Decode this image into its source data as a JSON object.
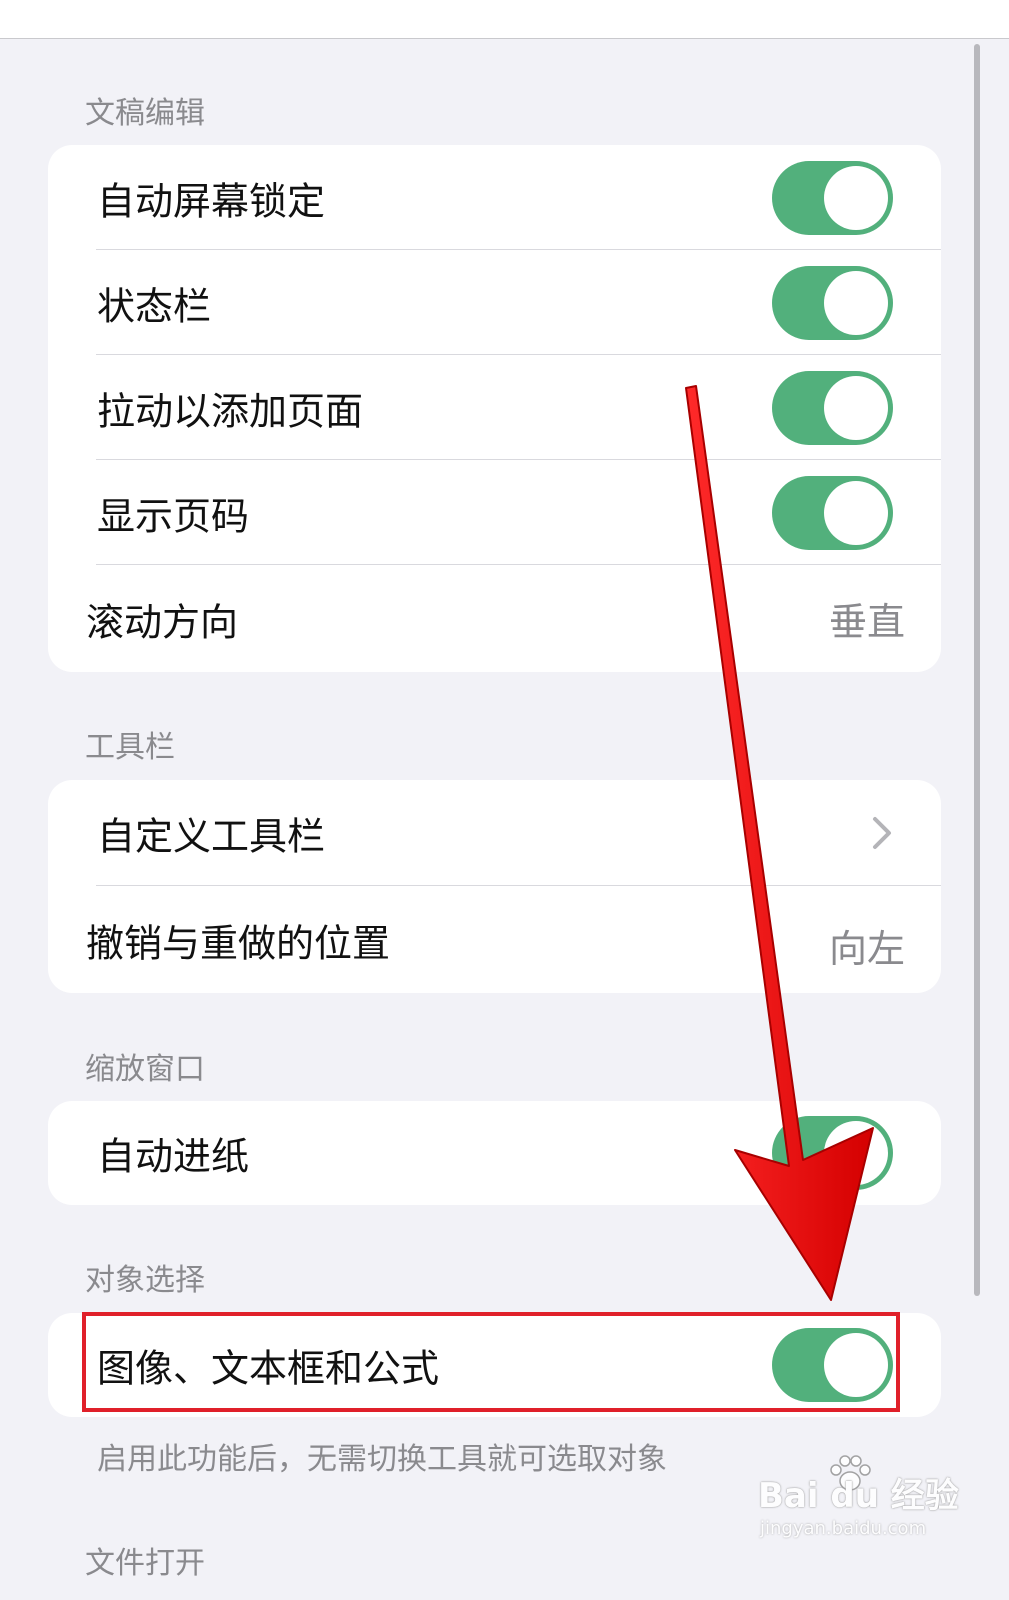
{
  "colors": {
    "toggle_on": "#52b07c",
    "background": "#f2f2f7",
    "annotation_red": "#e0202a"
  },
  "sections": [
    {
      "header": "文稿编辑",
      "rows": [
        {
          "label": "自动屏幕锁定",
          "type": "toggle",
          "on": true
        },
        {
          "label": "状态栏",
          "type": "toggle",
          "on": true
        },
        {
          "label": "拉动以添加页面",
          "type": "toggle",
          "on": true
        },
        {
          "label": "显示页码",
          "type": "toggle",
          "on": true
        },
        {
          "label": "滚动方向",
          "type": "value",
          "value": "垂直"
        }
      ]
    },
    {
      "header": "工具栏",
      "rows": [
        {
          "label": "自定义工具栏",
          "type": "disclosure",
          "icon": "chevron-right-icon"
        },
        {
          "label": "撤销与重做的位置",
          "type": "value",
          "value": "向左"
        }
      ]
    },
    {
      "header": "缩放窗口",
      "rows": [
        {
          "label": "自动进纸",
          "type": "toggle",
          "on": true
        }
      ]
    },
    {
      "header": "对象选择",
      "rows": [
        {
          "label": "图像、文本框和公式",
          "type": "toggle",
          "on": true
        }
      ],
      "footer": "启用此功能后，无需切换工具就可选取对象"
    },
    {
      "header": "文件打开"
    }
  ],
  "watermark": {
    "logo": "Bai du 经验",
    "url": "jingyan.baidu.com"
  }
}
